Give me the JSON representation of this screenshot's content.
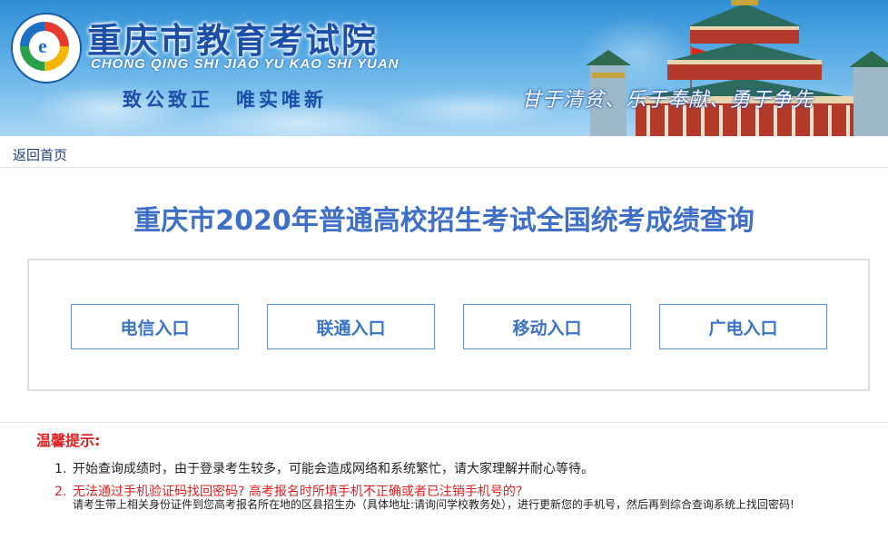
{
  "header": {
    "site_title": "重庆市教育考试院",
    "site_pinyin": "CHONG QING SHI JIAO YU KAO SHI YUAN",
    "motto_left": "致公致正　唯实唯新",
    "motto_right": "甘于清贫、乐于奉献、勇于争先",
    "logo_icon": "exam-authority-logo-icon"
  },
  "nav": {
    "home_link": "返回首页"
  },
  "page_title": "重庆市2020年普通高校招生考试全国统考成绩查询",
  "entries": [
    {
      "label": "电信入口"
    },
    {
      "label": "联通入口"
    },
    {
      "label": "移动入口"
    },
    {
      "label": "广电入口"
    }
  ],
  "tips": {
    "title": "温馨提示:",
    "items": [
      {
        "num": "1.",
        "text": "开始查询成绩时，由于登录考生较多，可能会造成网络和系统繁忙，请大家理解并耐心等待。"
      },
      {
        "num": "2.",
        "text": "无法通过手机验证码找回密码? 高考报名时所填手机不正确或者已注销手机号的?",
        "detail": "请考生带上相关身份证件到您高考报名所在地的区县招生办（具体地址:请询问学校教务处），进行更新您的手机号，然后再到综合查询系统上找回密码!"
      }
    ]
  },
  "colors": {
    "title_blue": "#3f6fc6",
    "button_text": "#3b74c4",
    "tips_red": "#e02020"
  }
}
